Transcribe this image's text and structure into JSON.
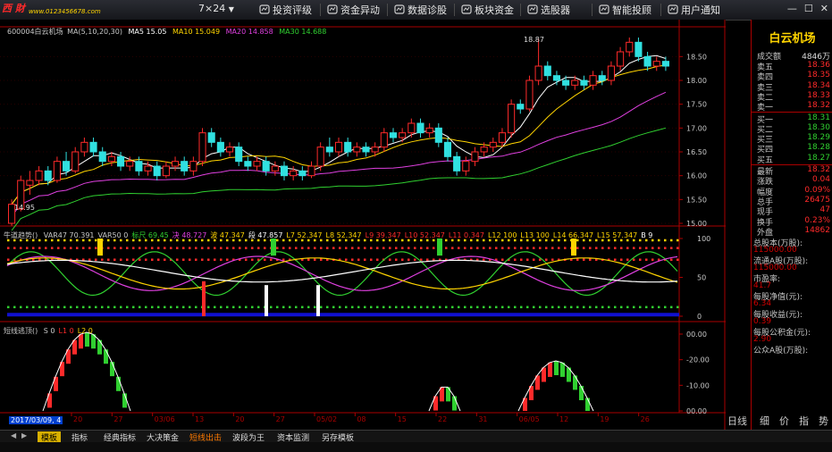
{
  "toolbar": {
    "brand": "西 財",
    "url": "www.0123456678.com",
    "news": "7×24",
    "items": [
      {
        "label": "投资评级",
        "icon": "rating-icon"
      },
      {
        "label": "资金异动",
        "icon": "money-icon"
      },
      {
        "label": "数据诊股",
        "icon": "diagnosis-icon"
      },
      {
        "label": "板块资金",
        "icon": "sector-icon"
      },
      {
        "label": "选股器",
        "icon": "stock-picker-icon"
      },
      {
        "label": "智能投顾",
        "icon": "robo-advisor-icon"
      },
      {
        "label": "用户通知",
        "icon": "notification-icon"
      }
    ]
  },
  "main_chart": {
    "stock_label": "600004白云机场",
    "ma_label": "MA(5,10,20,30)",
    "ma5": "MA5 15.05",
    "ma10": "MA10 15.049",
    "ma20": "MA20 14.858",
    "ma30": "MA30 14.688",
    "high_mark": "18.87",
    "low_mark": "14.95",
    "y_ticks": [
      "18.50",
      "18.00",
      "17.50",
      "17.00",
      "16.50",
      "16.00",
      "15.50",
      "15.00"
    ],
    "colors": {
      "ma5": "#ffffff",
      "ma10": "#ffd400",
      "ma20": "#e040e0",
      "ma30": "#30d030"
    }
  },
  "indicator1": {
    "name": "牛道趋势()",
    "vals": [
      {
        "t": "VAR47 70.391",
        "c": "#c8c8c8"
      },
      {
        "t": "VAR50 0",
        "c": "#c8c8c8"
      },
      {
        "t": "标尺 69.45",
        "c": "#30d030"
      },
      {
        "t": "决 48.727",
        "c": "#e040e0"
      },
      {
        "t": "波 47.347",
        "c": "#ffd400"
      },
      {
        "t": "段 47.857",
        "c": "#ffffff"
      },
      {
        "t": "L7 52.347",
        "c": "#ffd400"
      },
      {
        "t": "L8 52.347",
        "c": "#ffd400"
      },
      {
        "t": "L9 39.347",
        "c": "#ff2a2a"
      },
      {
        "t": "L10 52.347",
        "c": "#ff2a2a"
      },
      {
        "t": "L11 0.347",
        "c": "#ff2a2a"
      },
      {
        "t": "L12 100",
        "c": "#ffd400"
      },
      {
        "t": "L13 100",
        "c": "#ffd400"
      },
      {
        "t": "L14 66.347",
        "c": "#ffd400"
      },
      {
        "t": "L15 57.347",
        "c": "#ffd400"
      },
      {
        "t": "B 9",
        "c": "#ffffff"
      }
    ],
    "y_ticks": [
      "100",
      "50",
      "0"
    ]
  },
  "indicator2": {
    "name": "短线逃顶()",
    "vals": [
      {
        "t": "S 0",
        "c": "#c8c8c8"
      },
      {
        "t": "L1 0",
        "c": "#ff2a2a"
      },
      {
        "t": "L2 0",
        "c": "#ffd400"
      }
    ],
    "y_ticks": [
      "00.00",
      "-20.00",
      "-10.00",
      "00.00"
    ]
  },
  "date_axis": {
    "current": "2017/03/09, 4",
    "ticks": [
      "20",
      "27",
      "03/06",
      "13",
      "20",
      "27",
      "05/02",
      "08",
      "15",
      "22",
      "31",
      "06/05",
      "12",
      "19",
      "26"
    ]
  },
  "right_panel": {
    "title": "白云机场",
    "volume_label": "成交额",
    "volume_value": "4846万",
    "asks": [
      {
        "k": "卖五",
        "v": "18.36"
      },
      {
        "k": "卖四",
        "v": "18.35"
      },
      {
        "k": "卖三",
        "v": "18.34"
      },
      {
        "k": "卖二",
        "v": "18.33"
      },
      {
        "k": "卖一",
        "v": "18.32"
      }
    ],
    "bids": [
      {
        "k": "买一",
        "v": "18.31"
      },
      {
        "k": "买二",
        "v": "18.30"
      },
      {
        "k": "买三",
        "v": "18.29"
      },
      {
        "k": "买四",
        "v": "18.28"
      },
      {
        "k": "买五",
        "v": "18.27"
      }
    ],
    "quote": [
      {
        "k": "最新",
        "v": "18.32"
      },
      {
        "k": "涨跌",
        "v": "0.04"
      },
      {
        "k": "幅度",
        "v": "0.09%"
      },
      {
        "k": "总手",
        "v": "26475"
      },
      {
        "k": "现手",
        "v": "47"
      },
      {
        "k": "换手",
        "v": "0.23%"
      },
      {
        "k": "外盘",
        "v": "14862"
      }
    ],
    "fundamentals": [
      {
        "k": "总股本(万股):",
        "v": "115000.00"
      },
      {
        "k": "流通A股(万股):",
        "v": "115000.00"
      },
      {
        "k": "市盈率:",
        "v": "41.7"
      },
      {
        "k": "每股净值(元):",
        "v": "6.34"
      },
      {
        "k": "每股收益(元):",
        "v": "0.39"
      },
      {
        "k": "每股公积金(元):",
        "v": "2.90"
      },
      {
        "k": "公众A股(万股):",
        "v": ""
      }
    ],
    "bottom_left": "日线",
    "bottom_tabs": [
      "细",
      "价",
      "指",
      "势"
    ]
  },
  "bottom_tabs": [
    {
      "label": "模板",
      "active": true
    },
    {
      "label": "指标",
      "active": false
    },
    {
      "label": "经典指标",
      "active": false
    },
    {
      "label": "大决策金",
      "active": false
    },
    {
      "label": "短线出击",
      "active": false,
      "hl": true
    },
    {
      "label": "波段为王",
      "active": false
    },
    {
      "label": "资本监测",
      "active": false
    },
    {
      "label": "另存模板",
      "active": false
    }
  ],
  "chart_data": {
    "type": "candlestick",
    "title": "600004白云机场",
    "ylim": [
      15.0,
      18.9
    ],
    "candles": [
      [
        15.0,
        15.4,
        14.95,
        15.5
      ],
      [
        15.3,
        15.9,
        15.25,
        16.0
      ],
      [
        15.8,
        15.9,
        15.6,
        16.1
      ],
      [
        15.9,
        16.1,
        15.8,
        16.2
      ],
      [
        16.1,
        15.9,
        15.8,
        16.2
      ],
      [
        15.9,
        16.3,
        15.85,
        16.4
      ],
      [
        16.3,
        16.1,
        16.0,
        16.5
      ],
      [
        16.1,
        16.5,
        16.05,
        16.6
      ],
      [
        16.5,
        16.7,
        16.4,
        16.8
      ],
      [
        16.7,
        16.5,
        16.4,
        16.8
      ],
      [
        16.5,
        16.3,
        16.2,
        16.6
      ],
      [
        16.3,
        16.4,
        16.2,
        16.5
      ],
      [
        16.4,
        16.2,
        16.1,
        16.5
      ],
      [
        16.2,
        16.3,
        16.1,
        16.4
      ],
      [
        16.3,
        16.1,
        16.0,
        16.4
      ],
      [
        16.1,
        16.2,
        16.0,
        16.3
      ],
      [
        16.2,
        16.0,
        15.9,
        16.3
      ],
      [
        16.0,
        16.2,
        15.95,
        16.3
      ],
      [
        16.2,
        16.3,
        16.1,
        16.4
      ],
      [
        16.3,
        16.1,
        16.0,
        16.4
      ],
      [
        16.1,
        16.3,
        16.0,
        16.4
      ],
      [
        16.3,
        16.9,
        16.2,
        17.0
      ],
      [
        16.9,
        16.7,
        16.6,
        17.0
      ],
      [
        16.7,
        16.5,
        16.4,
        16.8
      ],
      [
        16.5,
        16.6,
        16.4,
        16.7
      ],
      [
        16.6,
        16.3,
        16.2,
        16.7
      ],
      [
        16.3,
        16.2,
        16.1,
        16.4
      ],
      [
        16.2,
        16.3,
        16.1,
        16.4
      ],
      [
        16.3,
        16.1,
        16.0,
        16.4
      ],
      [
        16.1,
        16.2,
        16.0,
        16.3
      ],
      [
        16.2,
        16.0,
        15.9,
        16.3
      ],
      [
        16.0,
        16.1,
        15.9,
        16.2
      ],
      [
        16.1,
        16.0,
        15.9,
        16.2
      ],
      [
        16.0,
        16.2,
        15.95,
        16.3
      ],
      [
        16.2,
        16.6,
        16.1,
        16.7
      ],
      [
        16.6,
        16.5,
        16.4,
        16.8
      ],
      [
        16.5,
        16.7,
        16.4,
        16.8
      ],
      [
        16.7,
        16.5,
        16.4,
        16.8
      ],
      [
        16.5,
        16.6,
        16.4,
        16.7
      ],
      [
        16.6,
        16.5,
        16.4,
        16.7
      ],
      [
        16.5,
        16.6,
        16.4,
        16.7
      ],
      [
        16.6,
        16.9,
        16.5,
        17.0
      ],
      [
        16.9,
        16.8,
        16.7,
        17.0
      ],
      [
        16.8,
        16.9,
        16.7,
        17.0
      ],
      [
        16.9,
        17.1,
        16.8,
        17.2
      ],
      [
        17.1,
        16.9,
        16.8,
        17.2
      ],
      [
        16.9,
        17.0,
        16.8,
        17.1
      ],
      [
        17.0,
        16.7,
        16.6,
        17.1
      ],
      [
        16.7,
        16.4,
        16.3,
        16.8
      ],
      [
        16.4,
        16.1,
        16.0,
        16.5
      ],
      [
        16.1,
        16.3,
        16.0,
        16.4
      ],
      [
        16.3,
        16.5,
        16.2,
        16.6
      ],
      [
        16.5,
        16.6,
        16.4,
        16.7
      ],
      [
        16.6,
        16.7,
        16.5,
        16.8
      ],
      [
        16.7,
        16.9,
        16.6,
        17.0
      ],
      [
        16.9,
        17.5,
        16.8,
        17.6
      ],
      [
        17.5,
        17.4,
        17.3,
        17.6
      ],
      [
        17.4,
        18.0,
        17.35,
        18.1
      ],
      [
        18.0,
        18.3,
        17.9,
        18.87
      ],
      [
        18.3,
        18.1,
        18.0,
        18.4
      ],
      [
        18.1,
        18.0,
        17.9,
        18.2
      ],
      [
        18.0,
        17.9,
        17.8,
        18.1
      ],
      [
        17.9,
        18.0,
        17.8,
        18.1
      ],
      [
        18.0,
        17.9,
        17.8,
        18.1
      ],
      [
        17.9,
        18.1,
        17.8,
        18.2
      ],
      [
        18.1,
        18.0,
        17.9,
        18.2
      ],
      [
        18.0,
        18.3,
        17.9,
        18.4
      ],
      [
        18.3,
        18.6,
        18.2,
        18.7
      ],
      [
        18.6,
        18.8,
        18.5,
        18.9
      ],
      [
        18.8,
        18.5,
        18.4,
        18.9
      ],
      [
        18.5,
        18.3,
        18.2,
        18.6
      ],
      [
        18.3,
        18.4,
        18.2,
        18.5
      ],
      [
        18.4,
        18.3,
        18.2,
        18.5
      ]
    ]
  }
}
